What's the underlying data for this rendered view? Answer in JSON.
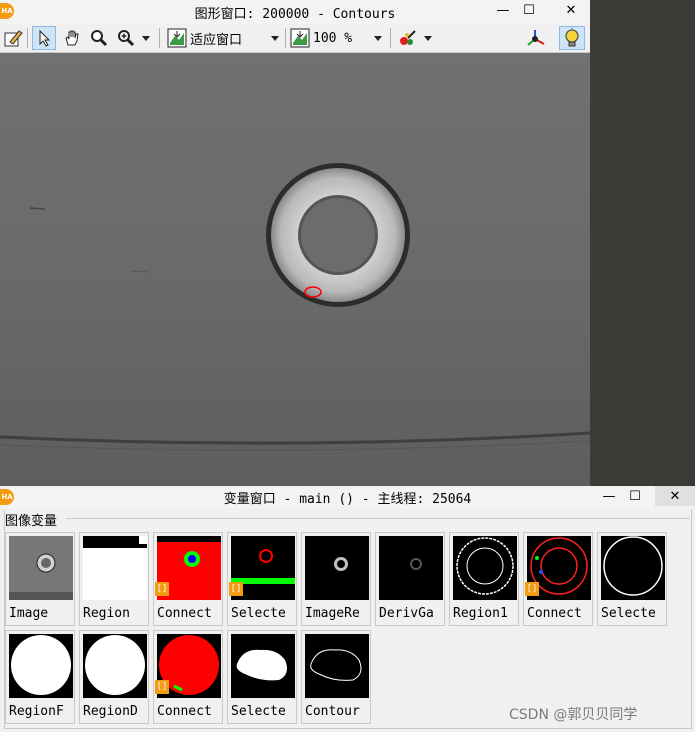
{
  "graphics_window": {
    "title": "图形窗口: 200000 - Contours",
    "minimize_label": "—",
    "maximize_label": "☐",
    "close_label": "✕",
    "toolbar": {
      "zoom_mode": "适应窗口",
      "zoom_percent": "100 %"
    }
  },
  "variable_window": {
    "title": "变量窗口 - main () - 主线程: 25064",
    "minimize_label": "—",
    "maximize_label": "☐",
    "close_label": "✕",
    "group_label": "图像变量",
    "tiles": [
      {
        "label": "Image"
      },
      {
        "label": "Region"
      },
      {
        "label": "Connect",
        "tag": "[]"
      },
      {
        "label": "Selecte",
        "tag": "[]"
      },
      {
        "label": "ImageRe"
      },
      {
        "label": "DerivGa"
      },
      {
        "label": "Region1"
      },
      {
        "label": "Connect",
        "tag": "[]"
      },
      {
        "label": "Selecte"
      },
      {
        "label": "RegionF"
      },
      {
        "label": "RegionD"
      },
      {
        "label": "Connect",
        "tag": "[]"
      },
      {
        "label": "Selecte"
      },
      {
        "label": "Contour"
      }
    ]
  },
  "watermark": "CSDN @郭贝贝同学",
  "colors": {
    "accent": "#f39c12",
    "region_red": "#ff0000",
    "region_green": "#00ff00"
  }
}
